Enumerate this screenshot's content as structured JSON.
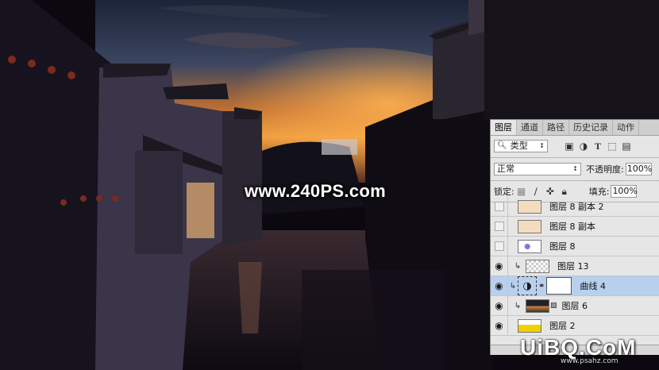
{
  "watermark_text": "www.240PS.com",
  "brand": {
    "logo": "UiBQ.CoM",
    "sub": "www.psahz.com"
  },
  "panel": {
    "tabs": [
      {
        "label": "图层",
        "active": true
      },
      {
        "label": "通道",
        "active": false
      },
      {
        "label": "路径",
        "active": false
      },
      {
        "label": "历史记录",
        "active": false
      },
      {
        "label": "动作",
        "active": false
      }
    ],
    "filter": {
      "search_icon": "search-icon",
      "label": "类型",
      "icons": [
        "image-icon",
        "adjust-icon",
        "text-icon",
        "shape-icon",
        "smart-icon"
      ]
    },
    "blend_mode": "正常",
    "opacity_label": "不透明度:",
    "opacity_value": "100%",
    "lock_label": "锁定:",
    "fill_label": "填充:",
    "fill_value": "100%",
    "layers": [
      {
        "name": "图层 8 副本 2",
        "visible": false,
        "clip": false,
        "thumb": "pale-orange",
        "selected": false
      },
      {
        "name": "图层 8 副本",
        "visible": false,
        "clip": false,
        "thumb": "pale-orange",
        "selected": false
      },
      {
        "name": "图层 8",
        "visible": false,
        "clip": false,
        "thumb": "violet-dot",
        "selected": false
      },
      {
        "name": "图层 13",
        "visible": true,
        "clip": true,
        "thumb": "transparent",
        "selected": false
      },
      {
        "name": "曲线 4",
        "visible": true,
        "clip": true,
        "thumb": "curves",
        "selected": true
      },
      {
        "name": "图层 6",
        "visible": true,
        "clip": true,
        "thumb": "photo",
        "selected": false
      },
      {
        "name": "图层 2",
        "visible": true,
        "clip": false,
        "thumb": "yellow",
        "selected": false
      }
    ]
  },
  "colors": {
    "panel_bg": "#e6e6e6",
    "selected_row": "#b8d0ee",
    "sky_glow": "#f0a040"
  }
}
